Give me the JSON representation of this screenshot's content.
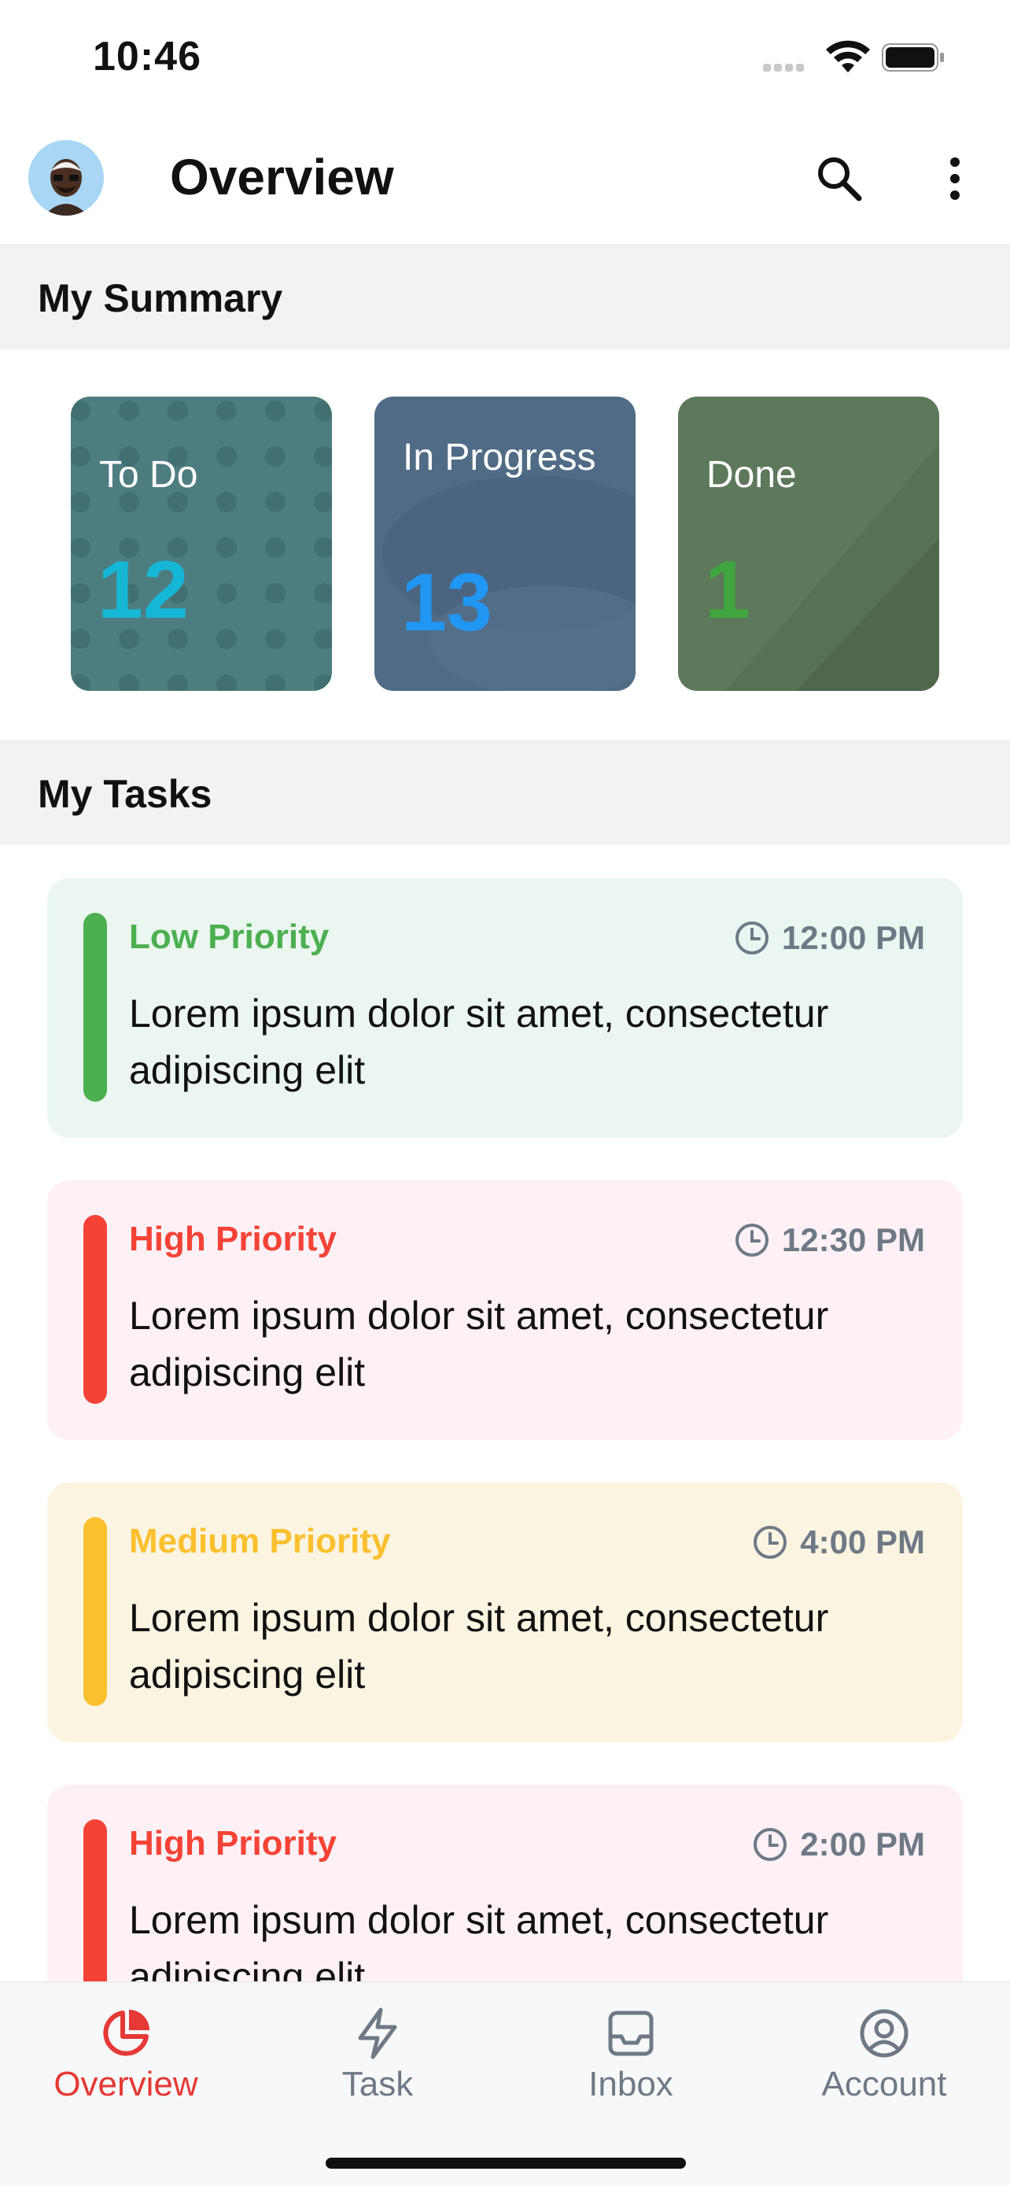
{
  "status_bar": {
    "time": "10:46"
  },
  "header": {
    "title": "Overview",
    "icons": [
      "avatar",
      "search-icon",
      "more-vertical-icon"
    ]
  },
  "summary": {
    "heading": "My Summary",
    "cards": [
      {
        "label": "To Do",
        "count": "12",
        "count_color": "#16b7d6",
        "bg": "#4e7d80"
      },
      {
        "label": "In Progress",
        "count": "13",
        "count_color": "#2196f3",
        "bg": "#506b86"
      },
      {
        "label": "Done",
        "count": "1",
        "count_color": "#3fa63f",
        "bg": "#5d785b"
      }
    ]
  },
  "tasks": {
    "heading": "My Tasks",
    "items": [
      {
        "priority": "Low Priority",
        "time": "12:00 PM",
        "description": "Lorem ipsum dolor sit amet, consectetur adipiscing elit",
        "accent": "#4caf50",
        "bg": "#eaf6ef"
      },
      {
        "priority": "High Priority",
        "time": "12:30 PM",
        "description": "Lorem ipsum dolor sit amet, consectetur adipiscing elit",
        "accent": "#f44336",
        "bg": "#fdf1f5"
      },
      {
        "priority": "Medium Priority",
        "time": "4:00 PM",
        "description": "Lorem ipsum dolor sit amet, consectetur adipiscing elit",
        "accent": "#fbc02d",
        "bg": "#fbf4e1"
      },
      {
        "priority": "High Priority",
        "time": "2:00 PM",
        "description": "Lorem ipsum dolor sit amet, consectetur adipiscing elit",
        "accent": "#f44336",
        "bg": "#fdf1f5"
      }
    ]
  },
  "bottom_nav": {
    "items": [
      {
        "label": "Overview",
        "icon": "pie-chart-icon",
        "active": true
      },
      {
        "label": "Task",
        "icon": "lightning-icon",
        "active": false
      },
      {
        "label": "Inbox",
        "icon": "inbox-icon",
        "active": false
      },
      {
        "label": "Account",
        "icon": "user-circle-icon",
        "active": false
      }
    ],
    "active_color": "#e53935",
    "inactive_color": "#6f7986"
  }
}
